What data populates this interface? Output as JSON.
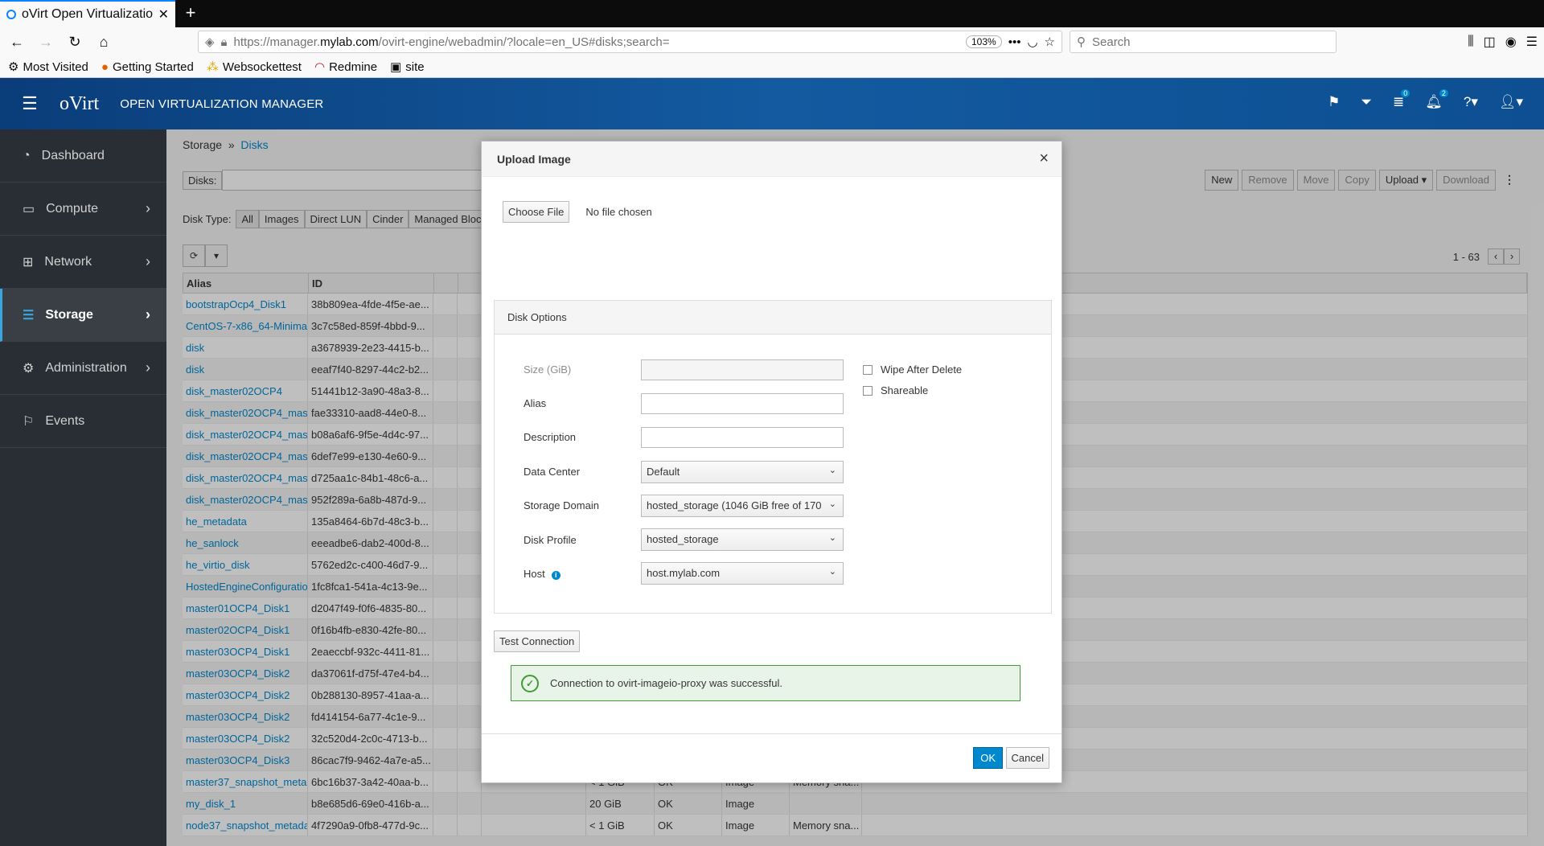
{
  "browser": {
    "tab_title": "oVirt Open Virtualization",
    "url_prefix": "https://manager.",
    "url_domain": "mylab.com",
    "url_path": "/ovirt-engine/webadmin/?locale=en_US#disks;search=",
    "zoom": "103%",
    "search_placeholder": "Search",
    "bookmarks": [
      "Most Visited",
      "Getting Started",
      "Websockettest",
      "Redmine",
      "site"
    ]
  },
  "header": {
    "brand": "oVirt",
    "app_name": "OPEN VIRTUALIZATION MANAGER",
    "tasks_badge": "0",
    "events_badge": "2"
  },
  "sidebar": {
    "items": [
      {
        "label": "Dashboard",
        "icon": "dashboard-icon"
      },
      {
        "label": "Compute",
        "icon": "compute-icon"
      },
      {
        "label": "Network",
        "icon": "network-icon"
      },
      {
        "label": "Storage",
        "icon": "storage-icon"
      },
      {
        "label": "Administration",
        "icon": "gear-icon"
      },
      {
        "label": "Events",
        "icon": "flag-icon"
      }
    ]
  },
  "page": {
    "breadcrumb_parent": "Storage",
    "breadcrumb_sep": "»",
    "breadcrumb_current": "Disks",
    "search_label": "Disks:",
    "actions": [
      "New",
      "Remove",
      "Move",
      "Copy",
      "Upload",
      "Download"
    ],
    "disk_type_label": "Disk Type:",
    "disk_types": [
      "All",
      "Images",
      "Direct LUN",
      "Cinder",
      "Managed Block"
    ],
    "pager": "1 - 63",
    "columns": [
      "Alias",
      "ID"
    ]
  },
  "rows": [
    {
      "alias": "bootstrapOcp4_Disk1",
      "id": "38b809ea-4fde-4f5e-ae..."
    },
    {
      "alias": "CentOS-7-x86_64-Minimal",
      "id": "3c7c58ed-859f-4bbd-9..."
    },
    {
      "alias": "disk",
      "id": "a3678939-2e23-4415-b..."
    },
    {
      "alias": "disk",
      "id": "eeaf7f40-8297-44c2-b2..."
    },
    {
      "alias": "disk_master02OCP4",
      "id": "51441b12-3a90-48a3-8..."
    },
    {
      "alias": "disk_master02OCP4_mast",
      "id": "fae33310-aad8-44e0-8..."
    },
    {
      "alias": "disk_master02OCP4_mast",
      "id": "b08a6af6-9f5e-4d4c-97..."
    },
    {
      "alias": "disk_master02OCP4_mast",
      "id": "6def7e99-e130-4e60-9..."
    },
    {
      "alias": "disk_master02OCP4_mast",
      "id": "d725aa1c-84b1-48c6-a..."
    },
    {
      "alias": "disk_master02OCP4_mast",
      "id": "952f289a-6a8b-487d-9..."
    },
    {
      "alias": "he_metadata",
      "id": "135a8464-6b7d-48c3-b..."
    },
    {
      "alias": "he_sanlock",
      "id": "eeeadbe6-dab2-400d-8..."
    },
    {
      "alias": "he_virtio_disk",
      "id": "5762ed2c-c400-46d7-9..."
    },
    {
      "alias": "HostedEngineConfiguratio",
      "id": "1fc8fca1-541a-4c13-9e..."
    },
    {
      "alias": "master01OCP4_Disk1",
      "id": "d2047f49-f0f6-4835-80..."
    },
    {
      "alias": "master02OCP4_Disk1",
      "id": "0f16b4fb-e830-42fe-80..."
    },
    {
      "alias": "master03OCP4_Disk1",
      "id": "2eaeccbf-932c-4411-81..."
    },
    {
      "alias": "master03OCP4_Disk2",
      "id": "da37061f-d75f-47e4-b4..."
    },
    {
      "alias": "master03OCP4_Disk2",
      "id": "0b288130-8957-41aa-a..."
    },
    {
      "alias": "master03OCP4_Disk2",
      "id": "fd414154-6a77-4c1e-9..."
    },
    {
      "alias": "master03OCP4_Disk2",
      "id": "32c520d4-2c0c-4713-b..."
    },
    {
      "alias": "master03OCP4_Disk3",
      "id": "86cac7f9-9462-4a7e-a5..."
    },
    {
      "alias": "master37_snapshot_meta",
      "id": "6bc16b37-3a42-40aa-b...",
      "size": "< 1 GiB",
      "status": "OK",
      "type": "Image",
      "desc": "Memory sna..."
    },
    {
      "alias": "my_disk_1",
      "id": "b8e685d6-69e0-416b-a...",
      "size": "20 GiB",
      "status": "OK",
      "type": "Image",
      "desc": ""
    },
    {
      "alias": "node37_snapshot_metada",
      "id": "4f7290a9-0fb8-477d-9c...",
      "size": "< 1 GiB",
      "status": "OK",
      "type": "Image",
      "desc": "Memory sna..."
    }
  ],
  "modal": {
    "title": "Upload Image",
    "choose_file": "Choose File",
    "no_file": "No file chosen",
    "disk_options": "Disk Options",
    "size_label": "Size (GiB)",
    "alias_label": "Alias",
    "description_label": "Description",
    "data_center_label": "Data Center",
    "data_center_value": "Default",
    "storage_domain_label": "Storage Domain",
    "storage_domain_value": "hosted_storage (1046 GiB free of 170",
    "disk_profile_label": "Disk Profile",
    "disk_profile_value": "hosted_storage",
    "host_label": "Host",
    "host_value": "host.mylab.com",
    "wipe_label": "Wipe After Delete",
    "shareable_label": "Shareable",
    "test_connection": "Test Connection",
    "success_msg": "Connection to ovirt-imageio-proxy was successful.",
    "ok": "OK",
    "cancel": "Cancel"
  }
}
